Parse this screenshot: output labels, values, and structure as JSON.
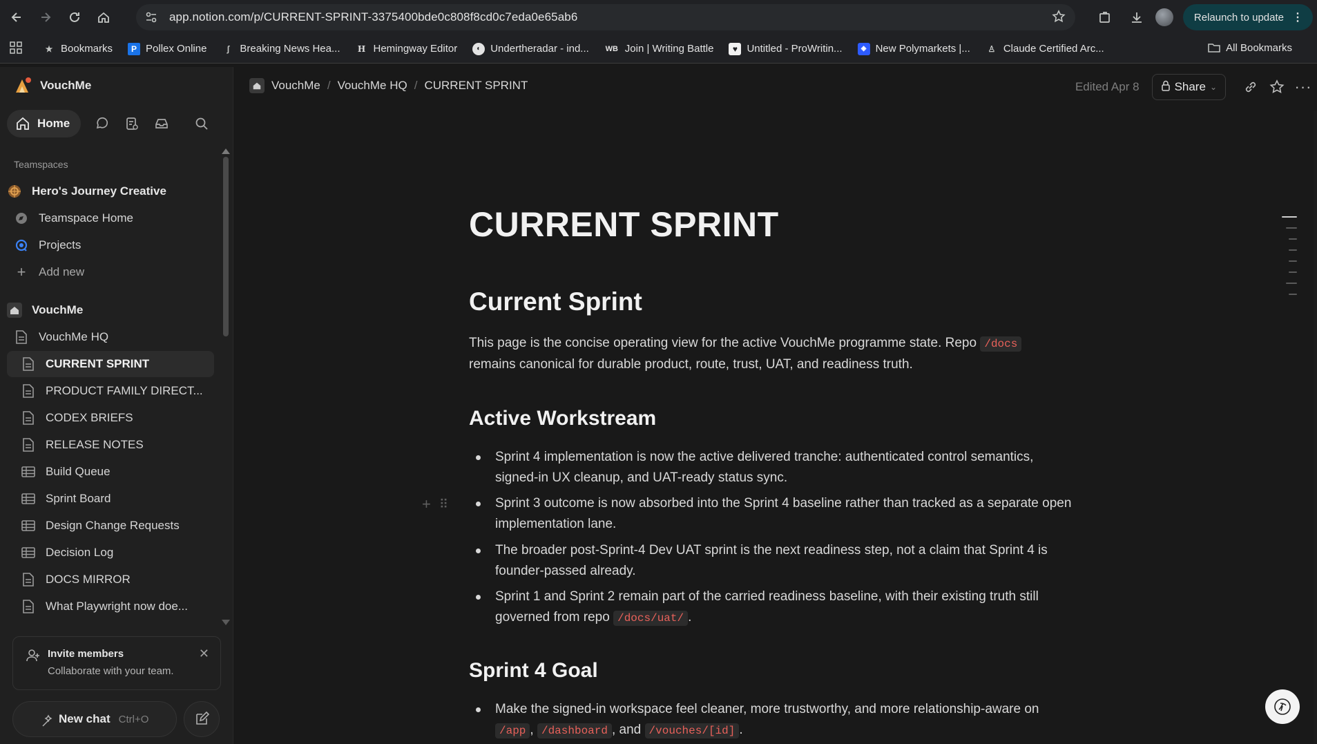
{
  "browser": {
    "url": "app.notion.com/p/CURRENT-SPRINT-3375400bde0c808f8cd0c7eda0e65ab6",
    "relaunch_label": "Relaunch to update",
    "bookmarks": [
      {
        "label": "Bookmarks",
        "icon": "star-icon"
      },
      {
        "label": "Pollex Online",
        "icon": "pollex-icon"
      },
      {
        "label": "Breaking News Hea...",
        "icon": "bookmark-icon"
      },
      {
        "label": "Hemingway Editor",
        "icon": "hemingway-icon"
      },
      {
        "label": "Undertheradar - ind...",
        "icon": "globe-icon"
      },
      {
        "label": "Join | Writing Battle",
        "icon": "wb-icon"
      },
      {
        "label": "Untitled - ProWritin...",
        "icon": "prowriting-icon"
      },
      {
        "label": "New Polymarkets |...",
        "icon": "polymarket-icon"
      },
      {
        "label": "Claude Certified Arc...",
        "icon": "badge-icon"
      }
    ],
    "all_bookmarks": "All Bookmarks"
  },
  "sidebar": {
    "workspace": "VouchMe",
    "home_label": "Home",
    "teamspaces_label": "Teamspaces",
    "teamspace_items": [
      {
        "label": "Hero's Journey Creative"
      },
      {
        "label": "Teamspace Home"
      },
      {
        "label": "Projects"
      },
      {
        "label": "Add new"
      }
    ],
    "pages": [
      {
        "label": "VouchMe"
      },
      {
        "label": "VouchMe HQ"
      },
      {
        "label": "CURRENT SPRINT"
      },
      {
        "label": "PRODUCT FAMILY DIRECT..."
      },
      {
        "label": "CODEX BRIEFS"
      },
      {
        "label": "RELEASE NOTES"
      },
      {
        "label": "Build Queue"
      },
      {
        "label": "Sprint Board"
      },
      {
        "label": "Design Change Requests"
      },
      {
        "label": "Decision Log"
      },
      {
        "label": "DOCS MIRROR"
      },
      {
        "label": "What Playwright now doe..."
      }
    ],
    "invite": {
      "title": "Invite members",
      "subtitle": "Collaborate with your team."
    },
    "new_chat": {
      "label": "New chat",
      "shortcut": "Ctrl+O"
    }
  },
  "header": {
    "breadcrumbs": [
      "VouchMe",
      "VouchMe HQ",
      "CURRENT SPRINT"
    ],
    "edited": "Edited Apr 8",
    "share_label": "Share"
  },
  "page": {
    "title": "CURRENT SPRINT",
    "heading": "Current Sprint",
    "intro_1": "This page is the concise operating view for the active VouchMe programme state. Repo ",
    "intro_code": "/docs",
    "intro_2": "remains canonical for durable product, route, trust, UAT, and readiness truth.",
    "section_workstream": "Active Workstream",
    "bullets": [
      "Sprint 4 implementation is now the active delivered tranche: authenticated control semantics, signed-in UX cleanup, and UAT-ready status sync.",
      "Sprint 3 outcome is now absorbed into the Sprint 4 baseline rather than tracked as a separate open implementation lane.",
      "The broader post-Sprint-4 Dev UAT sprint is the next readiness step, not a claim that Sprint 4 is founder-passed already."
    ],
    "bullet4_text": "Sprint 1 and Sprint 2 remain part of the carried readiness baseline, with their existing truth still governed from repo ",
    "bullet4_code": "/docs/uat/",
    "bullet4_end": ".",
    "section_goal": "Sprint 4 Goal",
    "goal_text": "Make the signed-in workspace feel cleaner, more trustworthy, and more relationship-aware on",
    "goal_code_1": "/app",
    "goal_comma": ",",
    "goal_code_2": "/dashboard",
    "goal_and": ", and",
    "goal_code_3": "/vouches/[id]",
    "goal_end": "."
  }
}
